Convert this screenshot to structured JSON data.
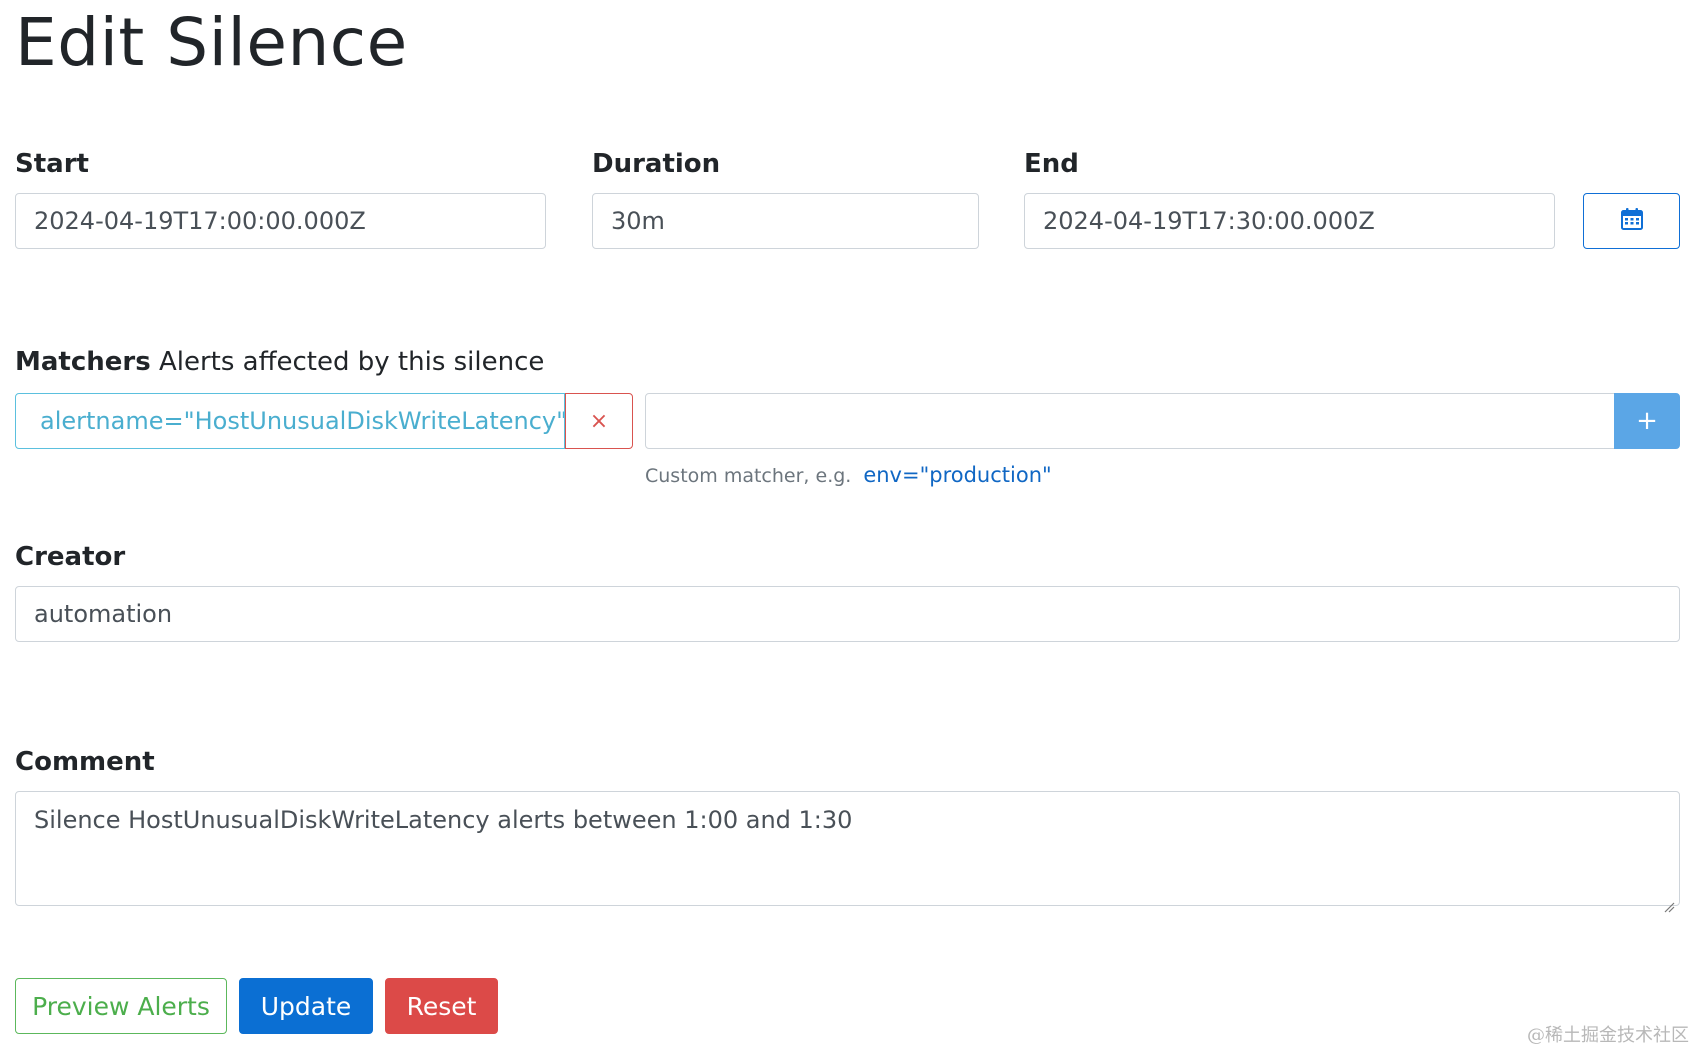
{
  "page": {
    "title": "Edit Silence"
  },
  "start": {
    "label": "Start",
    "value": "2024-04-19T17:00:00.000Z"
  },
  "duration": {
    "label": "Duration",
    "value": "30m"
  },
  "end": {
    "label": "End",
    "value": "2024-04-19T17:30:00.000Z",
    "picker_icon": "calendar-icon"
  },
  "matchers": {
    "heading": "Matchers",
    "subheading": "Alerts affected by this silence",
    "items": [
      {
        "text": "alertname=\"HostUnusualDiskWriteLatency\"",
        "remove_label": "×"
      }
    ],
    "new_matcher": {
      "value": "",
      "add_label": "+",
      "hint": "Custom matcher, e.g.",
      "hint_example": "env=\"production\""
    }
  },
  "creator": {
    "label": "Creator",
    "value": "automation"
  },
  "comment": {
    "label": "Comment",
    "value": "Silence HostUnusualDiskWriteLatency alerts between 1:00 and 1:30"
  },
  "actions": {
    "preview_label": "Preview Alerts",
    "update_label": "Update",
    "reset_label": "Reset"
  },
  "watermark": "@稀土掘金技术社区",
  "colors": {
    "primary": "#0b6fd3",
    "success": "#5cb85c",
    "danger": "#dc4a48",
    "info": "#5bc0de",
    "add_button": "#5ba6e6"
  }
}
